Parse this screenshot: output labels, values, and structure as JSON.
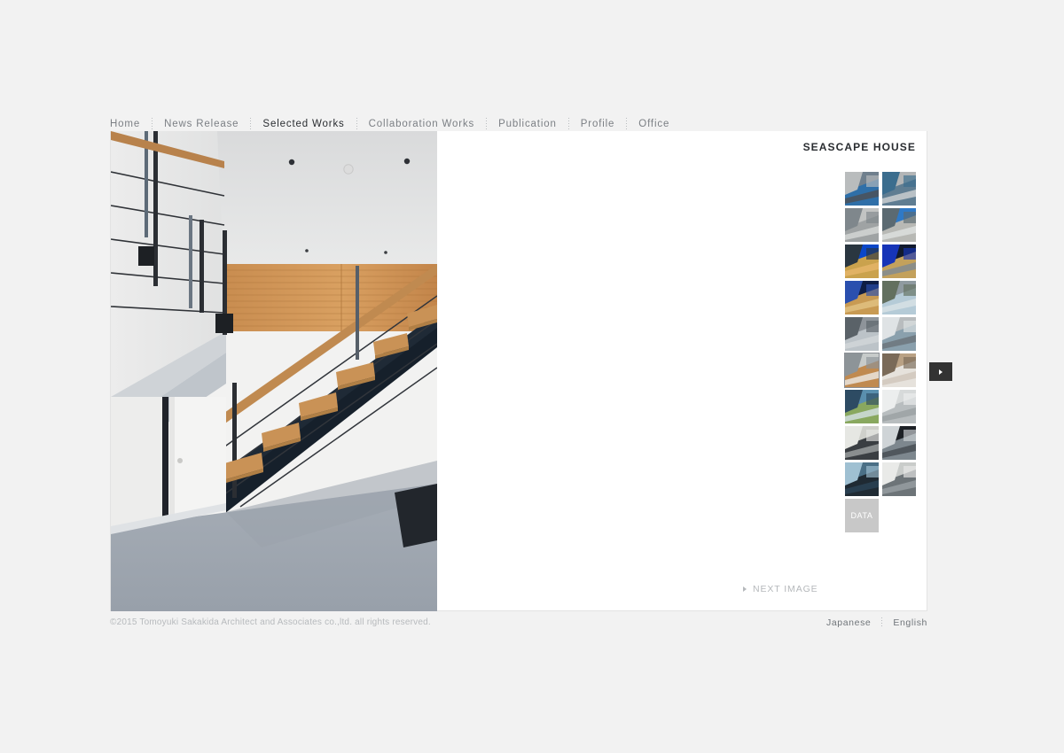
{
  "site": {
    "background_color": "#f2f2f2",
    "panel_color": "#ffffff"
  },
  "nav": {
    "items": [
      {
        "label": "Home",
        "active": false
      },
      {
        "label": "News Release",
        "active": false
      },
      {
        "label": "Selected Works",
        "active": true
      },
      {
        "label": "Collaboration Works",
        "active": false
      },
      {
        "label": "Publication",
        "active": false
      },
      {
        "label": "Profile",
        "active": false
      },
      {
        "label": "Office",
        "active": false
      }
    ]
  },
  "work": {
    "title": "SEASCAPE HOUSE",
    "hero_alt": "interior-stair-photo",
    "next_image_label": "NEXT IMAGE",
    "data_button_label": "DATA"
  },
  "thumbnails": [
    {
      "name": "thumbnail-1",
      "alt": "exterior-terrace-mountain",
      "selected": false
    },
    {
      "name": "thumbnail-2",
      "alt": "concrete-wall-glazing",
      "selected": false
    },
    {
      "name": "thumbnail-3",
      "alt": "concrete-facade",
      "selected": false
    },
    {
      "name": "thumbnail-4",
      "alt": "roof-eave-blue-sky",
      "selected": false
    },
    {
      "name": "thumbnail-5",
      "alt": "dusk-exterior-lit",
      "selected": false
    },
    {
      "name": "thumbnail-6",
      "alt": "dusk-corner-window",
      "selected": false
    },
    {
      "name": "thumbnail-7",
      "alt": "night-interior-glow",
      "selected": false
    },
    {
      "name": "thumbnail-8",
      "alt": "eave-underside-garden",
      "selected": false
    },
    {
      "name": "thumbnail-9",
      "alt": "cantilever-soffit",
      "selected": false
    },
    {
      "name": "thumbnail-10",
      "alt": "courtyard-gap",
      "selected": false
    },
    {
      "name": "thumbnail-11",
      "alt": "stair-wood-slat-wall",
      "selected": true
    },
    {
      "name": "thumbnail-12",
      "alt": "handrail-detail",
      "selected": false
    },
    {
      "name": "thumbnail-13",
      "alt": "living-room-sea-view",
      "selected": false
    },
    {
      "name": "thumbnail-14",
      "alt": "white-partition-door",
      "selected": false
    },
    {
      "name": "thumbnail-15",
      "alt": "bath-with-window",
      "selected": false
    },
    {
      "name": "thumbnail-16",
      "alt": "dark-frame-interior",
      "selected": false
    },
    {
      "name": "thumbnail-17",
      "alt": "sea-view-lounge",
      "selected": false
    },
    {
      "name": "thumbnail-18",
      "alt": "glass-door-corner",
      "selected": false
    }
  ],
  "side_tab": {
    "icon": "chevron-right-icon"
  },
  "footer": {
    "copyright": "©2015 Tomoyuki Sakakida Architect and Associates co.,ltd. all rights reserved.",
    "languages": [
      {
        "label": "Japanese"
      },
      {
        "label": "English"
      }
    ]
  }
}
